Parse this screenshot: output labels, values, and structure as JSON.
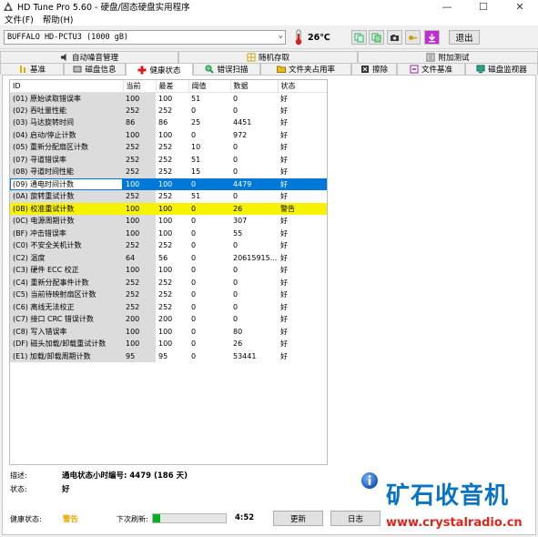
{
  "window": {
    "title": "HD Tune Pro 5.60 - 硬盘/固态硬盘实用程序",
    "minimize": "—",
    "maximize": "☐",
    "close": "✕"
  },
  "menu": {
    "file": "文件(F)",
    "help": "帮助(H)"
  },
  "toolbar": {
    "drive": "BUFFALO HD-PCTU3 (1000 gB)",
    "temperature": "26℃",
    "exit_label": "退出",
    "icons": [
      "copy-info-icon",
      "copy-screen-icon",
      "camera-icon",
      "key-icon",
      "download-icon"
    ]
  },
  "tabs": {
    "row1": [
      "自动噪音管理",
      "随机存取",
      "附加测试"
    ],
    "row2": [
      "基准",
      "磁盘信息",
      "健康状态",
      "错误扫描",
      "文件夹占用率",
      "擦除",
      "文件基准",
      "磁盘监视器"
    ],
    "active": "健康状态"
  },
  "table": {
    "headers": [
      "ID",
      "当前",
      "最差",
      "阈值",
      "数据",
      "状态"
    ],
    "rows": [
      [
        "(01) 原始读取错误率",
        "100",
        "100",
        "51",
        "0",
        "好"
      ],
      [
        "(02) 吞吐量性能",
        "252",
        "252",
        "0",
        "0",
        "好"
      ],
      [
        "(03) 马达旋转时间",
        "86",
        "86",
        "25",
        "4451",
        "好"
      ],
      [
        "(04) 启动/停止计数",
        "100",
        "100",
        "0",
        "972",
        "好"
      ],
      [
        "(05) 重新分配扇区计数",
        "252",
        "252",
        "10",
        "0",
        "好"
      ],
      [
        "(07) 寻道错误率",
        "252",
        "252",
        "51",
        "0",
        "好"
      ],
      [
        "(08) 寻道时间性能",
        "252",
        "252",
        "15",
        "0",
        "好"
      ],
      [
        "(09) 通电时间计数",
        "100",
        "100",
        "0",
        "4479",
        "好"
      ],
      [
        "(0A) 旋转重试计数",
        "252",
        "252",
        "51",
        "0",
        "好"
      ],
      [
        "(0B) 校准重试计数",
        "100",
        "100",
        "0",
        "26",
        "警告"
      ],
      [
        "(0C) 电源周期计数",
        "100",
        "100",
        "0",
        "307",
        "好"
      ],
      [
        "(BF) 冲击错误率",
        "100",
        "100",
        "0",
        "55",
        "好"
      ],
      [
        "(C0) 不安全关机计数",
        "252",
        "252",
        "0",
        "0",
        "好"
      ],
      [
        "(C2) 温度",
        "64",
        "56",
        "0",
        "20615915...",
        "好"
      ],
      [
        "(C3) 硬件 ECC 校正",
        "100",
        "100",
        "0",
        "0",
        "好"
      ],
      [
        "(C4) 重新分配事件计数",
        "252",
        "252",
        "0",
        "0",
        "好"
      ],
      [
        "(C5) 当前待映射扇区计数",
        "252",
        "252",
        "0",
        "0",
        "好"
      ],
      [
        "(C6) 离线无法校正",
        "252",
        "252",
        "0",
        "0",
        "好"
      ],
      [
        "(C7) 接口 CRC 错误计数",
        "200",
        "200",
        "0",
        "0",
        "好"
      ],
      [
        "(C8) 写入错误率",
        "100",
        "100",
        "0",
        "80",
        "好"
      ],
      [
        "(DF) 磁头加载/卸载重试计数",
        "100",
        "100",
        "0",
        "26",
        "好"
      ],
      [
        "(E1) 加载/卸载周期计数",
        "95",
        "95",
        "0",
        "53441",
        "好"
      ]
    ],
    "selected_row": 7,
    "warning_row": 9
  },
  "details": {
    "desc_label": "描述:",
    "desc_value": "通电状态小时编号: 4479 (186 天)",
    "status_label": "状态:",
    "status_value": "好"
  },
  "footer": {
    "health_label": "健康状态:",
    "health_value": "警告",
    "refresh_label": "下次刷新:",
    "refresh_progress": 0.1,
    "timer": "4:52",
    "update_btn": "更新",
    "log_btn": "日志"
  },
  "watermark": {
    "name": "矿石收音机",
    "url": "www.crystalradio.cn"
  },
  "colors": {
    "selected": "#0078d7",
    "warning_row": "#f7f200",
    "health_warning": "#e6a800",
    "progress": "#06b025",
    "watermark_blue": "#0a74c4",
    "watermark_red": "#e2231a"
  }
}
